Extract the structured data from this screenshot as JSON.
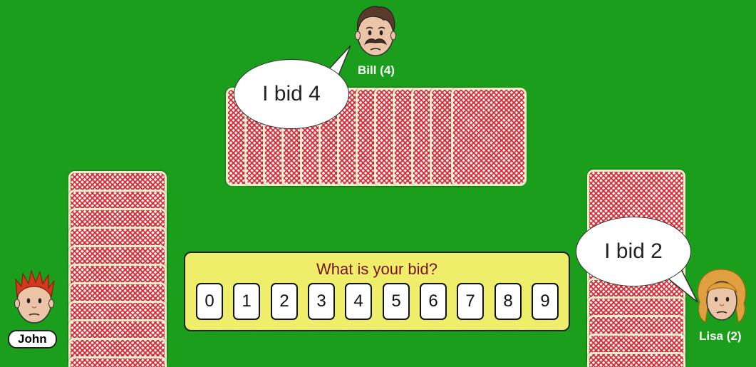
{
  "players": {
    "bill": {
      "label": "Bill (4)",
      "bubble": "I bid 4"
    },
    "lisa": {
      "label": "Lisa (2)",
      "bubble": "I bid 2"
    },
    "john": {
      "label": "John"
    }
  },
  "bid_panel": {
    "prompt": "What is your bid?",
    "options": [
      "0",
      "1",
      "2",
      "3",
      "4",
      "5",
      "6",
      "7",
      "8",
      "9"
    ]
  },
  "colors": {
    "table": "#1a9e1c",
    "card_back": "#d71e28",
    "panel": "#eeee6a",
    "prompt_text": "#7a1010"
  }
}
